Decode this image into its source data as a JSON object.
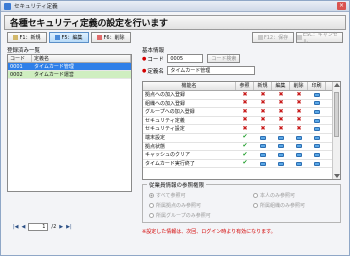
{
  "window": {
    "title": "セキュリティ定義"
  },
  "header": {
    "title": "各種セキュリティ定義の設定を行います"
  },
  "toolbar": {
    "new": "F1：新規",
    "edit": "F5：編集",
    "delete": "F6：削除",
    "save": "F12：保存",
    "cancel": "ESC：キャンセル"
  },
  "registered": {
    "label": "登録済み一覧",
    "columns": [
      "コード",
      "定義名"
    ],
    "rows": [
      {
        "code": "0001",
        "name": "タイムカード管理"
      },
      {
        "code": "0002",
        "name": "タイムカード運営"
      }
    ]
  },
  "pager": {
    "first": "|◀",
    "prev": "◀",
    "page": "1",
    "total": "/2",
    "next": "▶",
    "last": "▶|"
  },
  "basic": {
    "label": "基本情報",
    "code_label": "コード",
    "code_value": "0005",
    "code_search": "コード検索",
    "name_label": "定義名",
    "name_value": "タイムカード管理"
  },
  "permissions": {
    "columns": [
      "機能名",
      "参照",
      "新規",
      "編集",
      "削除",
      "印刷"
    ],
    "rows": [
      {
        "name": "拠点への加入登録",
        "marks": [
          "x",
          "x",
          "x",
          "x",
          "box"
        ]
      },
      {
        "name": "組織への加入登録",
        "marks": [
          "x",
          "x",
          "x",
          "x",
          "box"
        ]
      },
      {
        "name": "グループへの加入登録",
        "marks": [
          "x",
          "x",
          "x",
          "x",
          "box"
        ]
      },
      {
        "name": "セキュリティ定義",
        "marks": [
          "x",
          "x",
          "x",
          "x",
          "box"
        ]
      },
      {
        "name": "セキュリティ設定",
        "marks": [
          "x",
          "x",
          "x",
          "x",
          "box"
        ]
      },
      {
        "name": "端末設定",
        "marks": [
          "ok",
          "box",
          "box",
          "box",
          "box"
        ]
      },
      {
        "name": "拠点状態",
        "marks": [
          "ok",
          "box",
          "box",
          "box",
          "box"
        ]
      },
      {
        "name": "キャッシュのクリア",
        "marks": [
          "ok",
          "box",
          "box",
          "box",
          "box"
        ]
      },
      {
        "name": "タイムカード実行終了",
        "marks": [
          "ok",
          "box",
          "box",
          "box",
          "box"
        ]
      }
    ]
  },
  "scope": {
    "title": "従業員情報の参照権限",
    "options": [
      "すべて参照可",
      "本人のみ参照可",
      "所属拠点のみ参照可",
      "所属組織のみ参照可",
      "所属グループのみ参照可"
    ]
  },
  "note": "※設定した情報は、次回、ログイン時より有効になります。",
  "colors": {
    "selected": "#2f7fe8",
    "alt_row": "#cfeec0",
    "deny": "#c81919",
    "allow": "#1f9d2a",
    "warning": "#d40000"
  },
  "icons": {
    "close": "close-icon",
    "deny": "cross-icon",
    "allow": "check-icon"
  }
}
